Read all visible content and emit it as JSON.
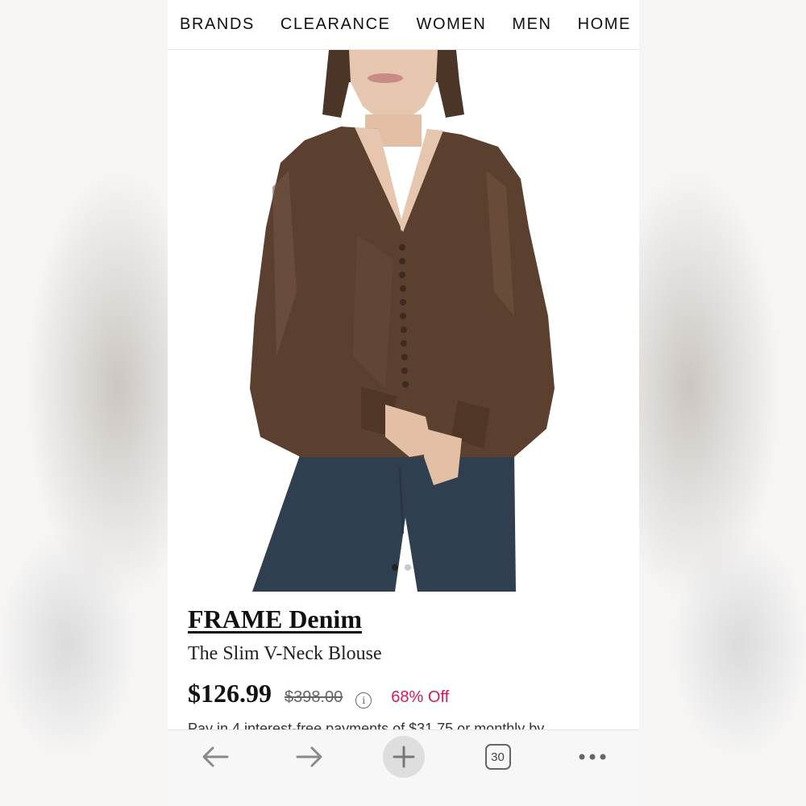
{
  "nav": {
    "items": [
      "BRANDS",
      "CLEARANCE",
      "WOMEN",
      "MEN",
      "HOME"
    ]
  },
  "product": {
    "brand": "FRAME Denim",
    "name": "The Slim V-Neck Blouse",
    "price": "$126.99",
    "original_price": "$398.00",
    "discount": "68% Off",
    "installments": "Pay in 4 interest-free payments of $31.75 or monthly by",
    "image_colors": {
      "blouse": "#5b4030",
      "jeans": "#2f3f4f",
      "hair": "#4a3526",
      "skin": "#e6c4ad"
    },
    "carousel": {
      "count": 2,
      "active": 1
    }
  },
  "toolbar": {
    "back_icon": "arrow-left-icon",
    "forward_icon": "arrow-right-icon",
    "new_tab_icon": "plus-icon",
    "tab_count": "30",
    "more_icon": "more-dots-icon"
  },
  "colors": {
    "discount": "#d6195a",
    "text": "#111111"
  }
}
